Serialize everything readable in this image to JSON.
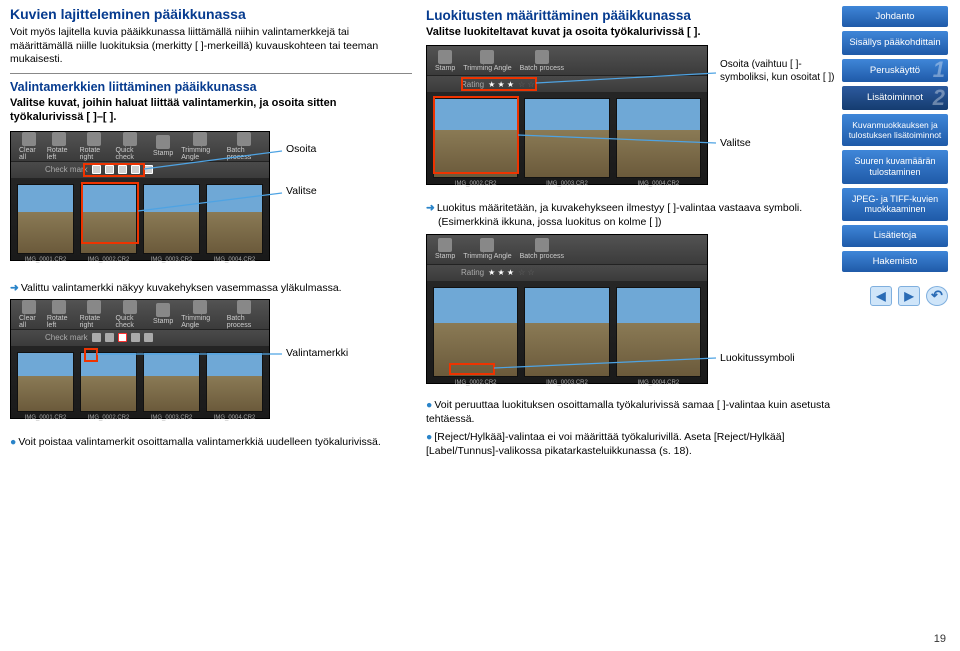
{
  "left": {
    "h_sort": "Kuvien lajitteleminen pääikkunassa",
    "intro": "Voit myös lajitella kuvia pääikkunassa liittämällä niihin valintamerkkejä tai määrittämällä niille luokituksia (merkitty [ ]-merkeillä) kuvauskohteen tai teeman mukaisesti.",
    "h_marks": "Valintamerkkien liittäminen pääikkunassa",
    "marks_sub": "Valitse kuvat, joihin haluat liittää valintamerkin, ja osoita sitten työkalurivissä [ ]–[ ].",
    "call_osoita": "Osoita",
    "call_valitse": "Valitse",
    "marks_res": "Valittu valintamerkki näkyy kuvakehyksen vasemmassa yläkulmassa.",
    "call_valintamerkki": "Valintamerkki",
    "marks_note": "Voit poistaa valintamerkit osoittamalla valintamerkkiä uudelleen työkalurivissä.",
    "toolbar_items": [
      "Clear all",
      "Rotate left",
      "Rotate right",
      "Quick check",
      "Stamp",
      "Trimming Angle",
      "Batch process"
    ],
    "rating_lbl": "Check mark",
    "thumb_names": [
      "IMG_0001.CR2",
      "IMG_0002.CR2",
      "IMG_0003.CR2",
      "IMG_0004.CR2"
    ]
  },
  "mid": {
    "h_ratings": "Luokitusten määrittäminen pääikkunassa",
    "ratings_sub": "Valitse luokiteltavat kuvat ja osoita työkalurivissä [ ].",
    "call_point1": "Osoita (vaihtuu [ ]-symboliksi, kun osoitat [ ])",
    "call_valitse": "Valitse",
    "res1a": "Luokitus määritetään, ja kuvakehykseen ilmestyy [ ]-valintaa vastaava symboli.",
    "res1b": "(Esimerkkinä ikkuna, jossa luokitus on kolme [ ])",
    "call_symbol": "Luokitussymboli",
    "note1": "Voit peruuttaa luokituksen osoittamalla työkalurivissä samaa [ ]-valintaa kuin asetusta tehtäessä.",
    "note2": "[Reject/Hylkää]-valintaa ei voi määrittää työkalurivillä. Aseta [Reject/Hylkää] [Label/Tunnus]-valikossa pikatarkasteluikkunassa (s. 18).",
    "rating_lbl": "Rating"
  },
  "right": {
    "btn_intro": "Johdanto",
    "btn_toc": "Sisällys pääkohdittain",
    "btn_basic": "Peruskäyttö",
    "btn_extra": "Lisätoiminnot",
    "btn_edit": "Kuvanmuokkauksen ja tulostuksen lisätoiminnot",
    "btn_print": "Suuren kuvamäärän tulostaminen",
    "btn_jpeg": "JPEG- ja TIFF-kuvien muokkaaminen",
    "btn_info": "Lisätietoja",
    "btn_index": "Hakemisto",
    "num1": "1",
    "num2": "2"
  },
  "page_number": "19"
}
